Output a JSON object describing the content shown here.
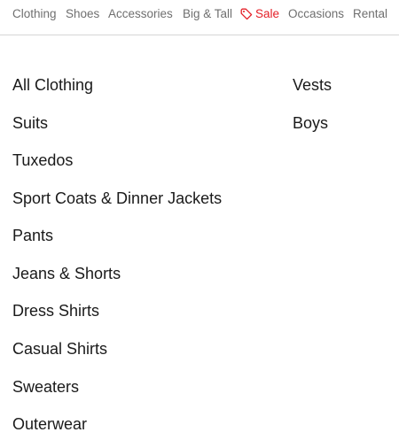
{
  "topnav": {
    "items": [
      {
        "label": "Clothing"
      },
      {
        "label": "Shoes"
      },
      {
        "label": "Accessories"
      },
      {
        "label": "Big & Tall"
      },
      {
        "label": "Sale",
        "icon": "tag-icon",
        "color": "#e41e26"
      },
      {
        "label": "Occasions"
      },
      {
        "label": "Rental"
      }
    ]
  },
  "menu": {
    "column1": [
      "All Clothing",
      "Suits",
      "Tuxedos",
      "Sport Coats & Dinner Jackets",
      "Pants",
      "Jeans & Shorts",
      "Dress Shirts",
      "Casual Shirts",
      "Sweaters",
      "Outerwear"
    ],
    "column2": [
      "Vests",
      "Boys"
    ]
  }
}
